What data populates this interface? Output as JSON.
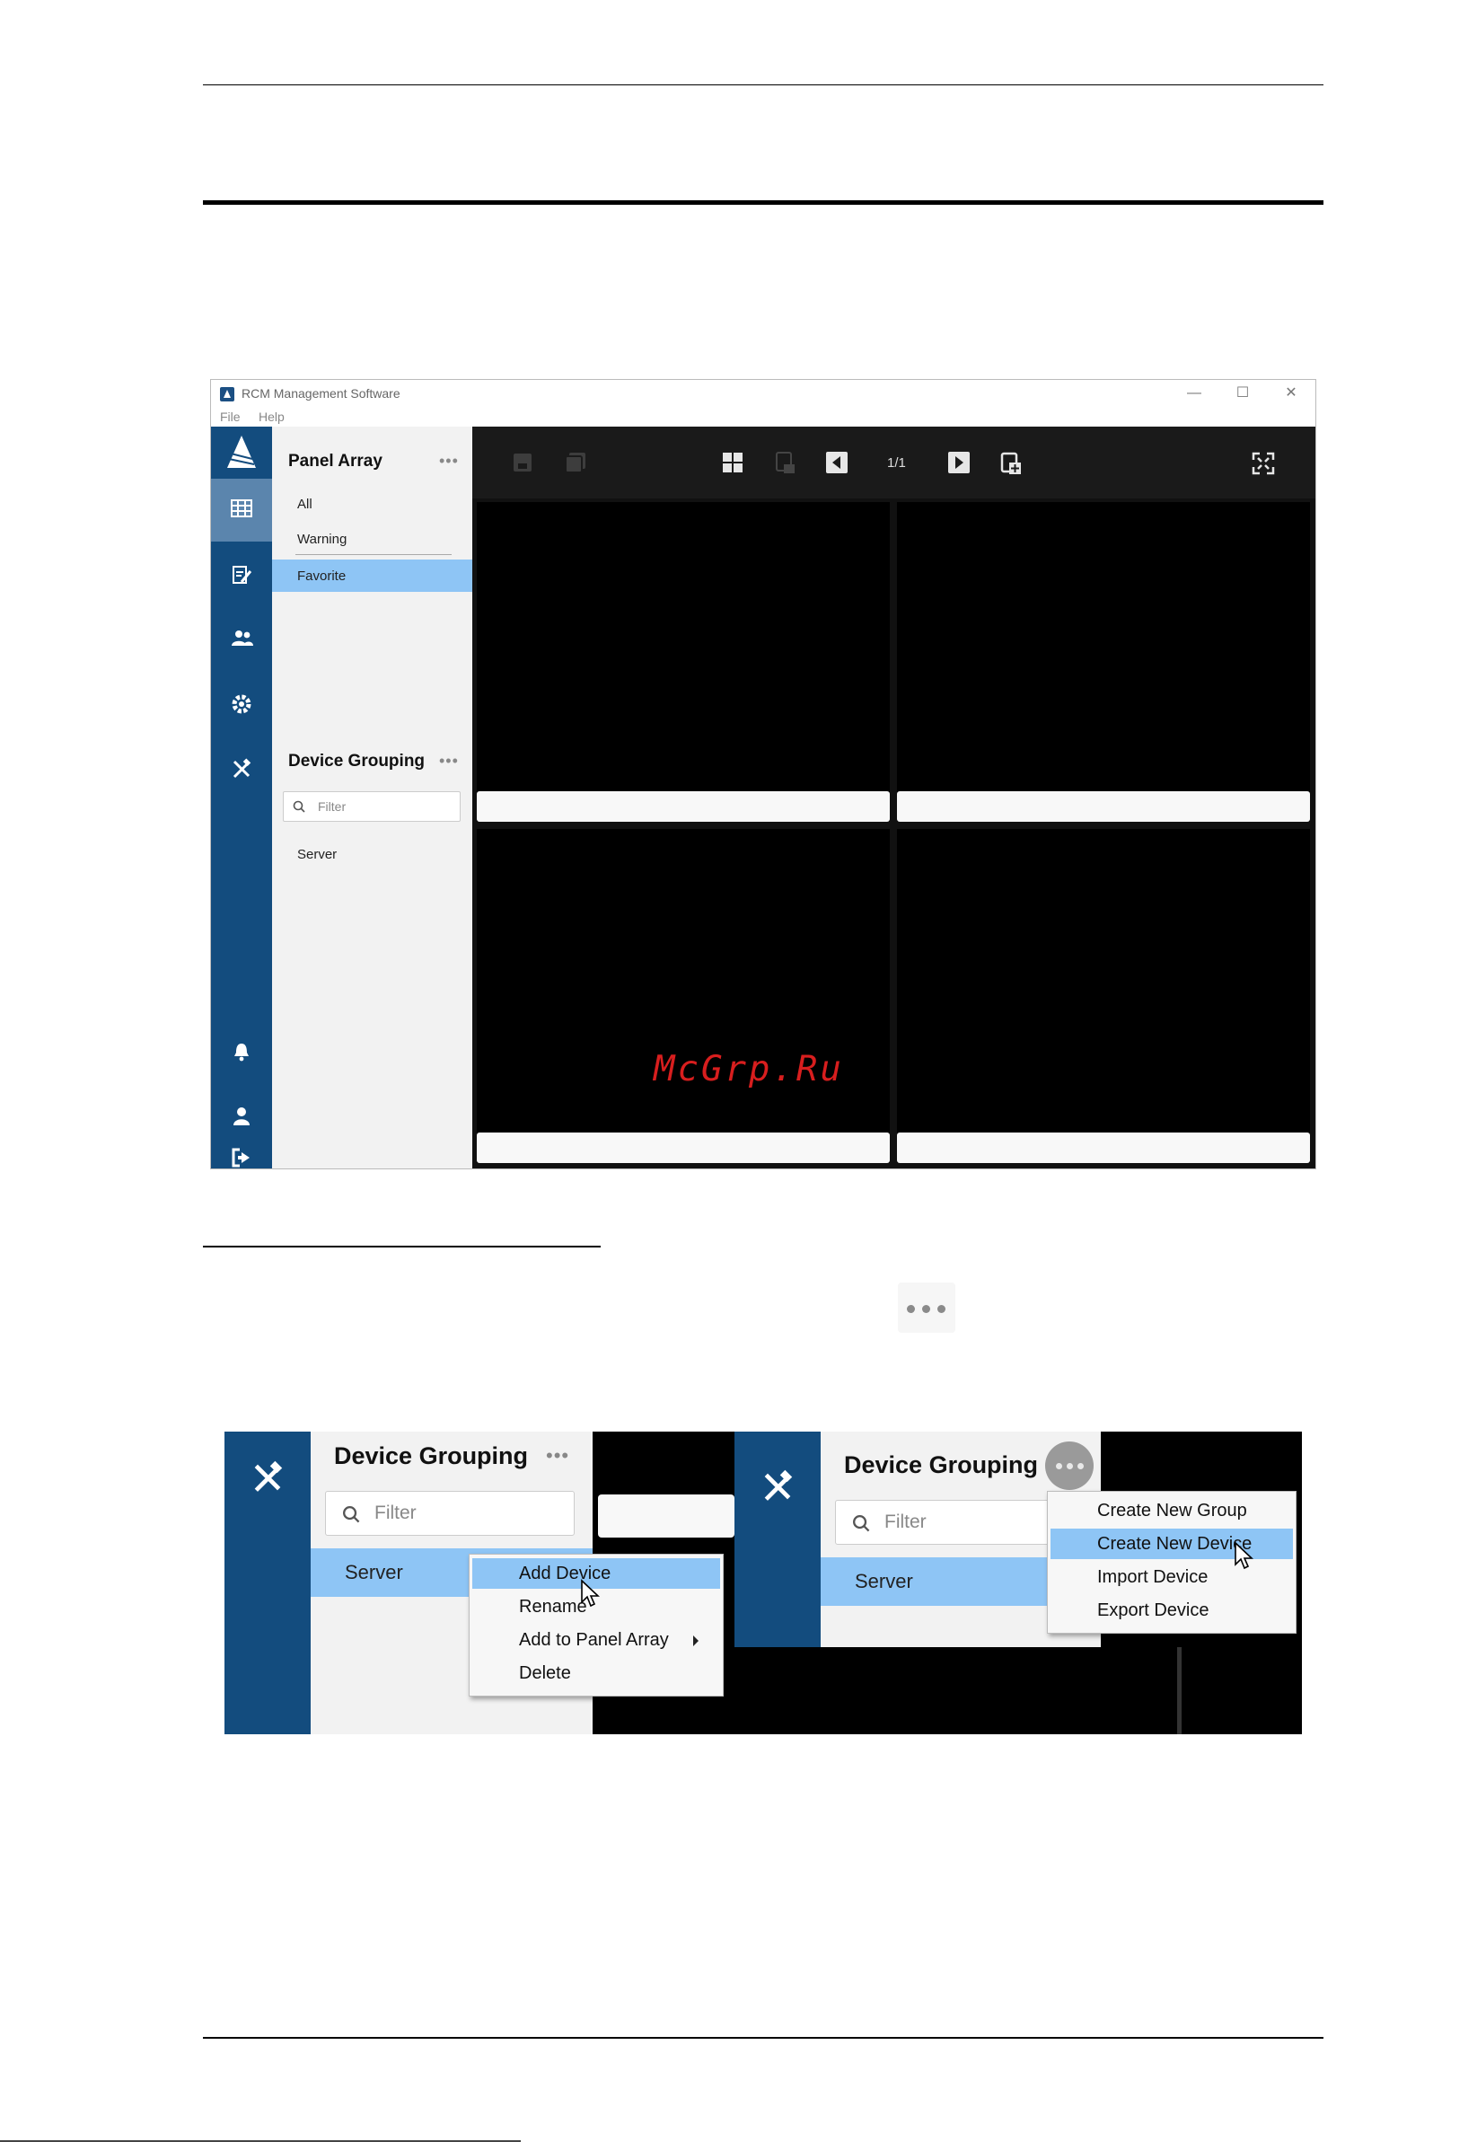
{
  "window": {
    "title": "RCM Management Software",
    "menu": [
      "File",
      "Help"
    ],
    "controls": [
      "—",
      "☐",
      "✕"
    ]
  },
  "panel_array": {
    "title": "Panel Array",
    "more": "•••",
    "items": [
      "All",
      "Warning",
      "Favorite"
    ]
  },
  "device_grouping": {
    "title": "Device Grouping",
    "more": "•••",
    "filter_placeholder": "Filter",
    "items": [
      "Server"
    ]
  },
  "toolbar": {
    "page_indicator": "1/1"
  },
  "watermark": "McGrp.Ru",
  "zoom_left": {
    "title": "Device Grouping",
    "more": "•••",
    "filter_placeholder": "Filter",
    "server": "Server",
    "context_menu": [
      "Add Device",
      "Rename",
      "Add to Panel Array",
      "Delete"
    ]
  },
  "zoom_right": {
    "title": "Device Grouping",
    "filter_placeholder": "Filter",
    "server": "Server",
    "context_menu": [
      "Create New Group",
      "Create New Device",
      "Import Device",
      "Export Device"
    ]
  },
  "icons": {
    "rail": [
      "grid-icon",
      "notes-icon",
      "users-icon",
      "gear-icon",
      "tools-icon",
      "bell-icon",
      "user-icon",
      "logout-icon"
    ],
    "toolbar": [
      "save-icon",
      "save-all-icon",
      "layout-grid-icon",
      "layout-remove-icon",
      "prev-page-icon",
      "next-page-icon",
      "add-page-icon",
      "fullscreen-icon"
    ]
  },
  "colors": {
    "rail": "#134c7e",
    "rail_active": "#5b85ad",
    "highlight": "#8ec5f5",
    "watermark": "#d81e1e"
  }
}
